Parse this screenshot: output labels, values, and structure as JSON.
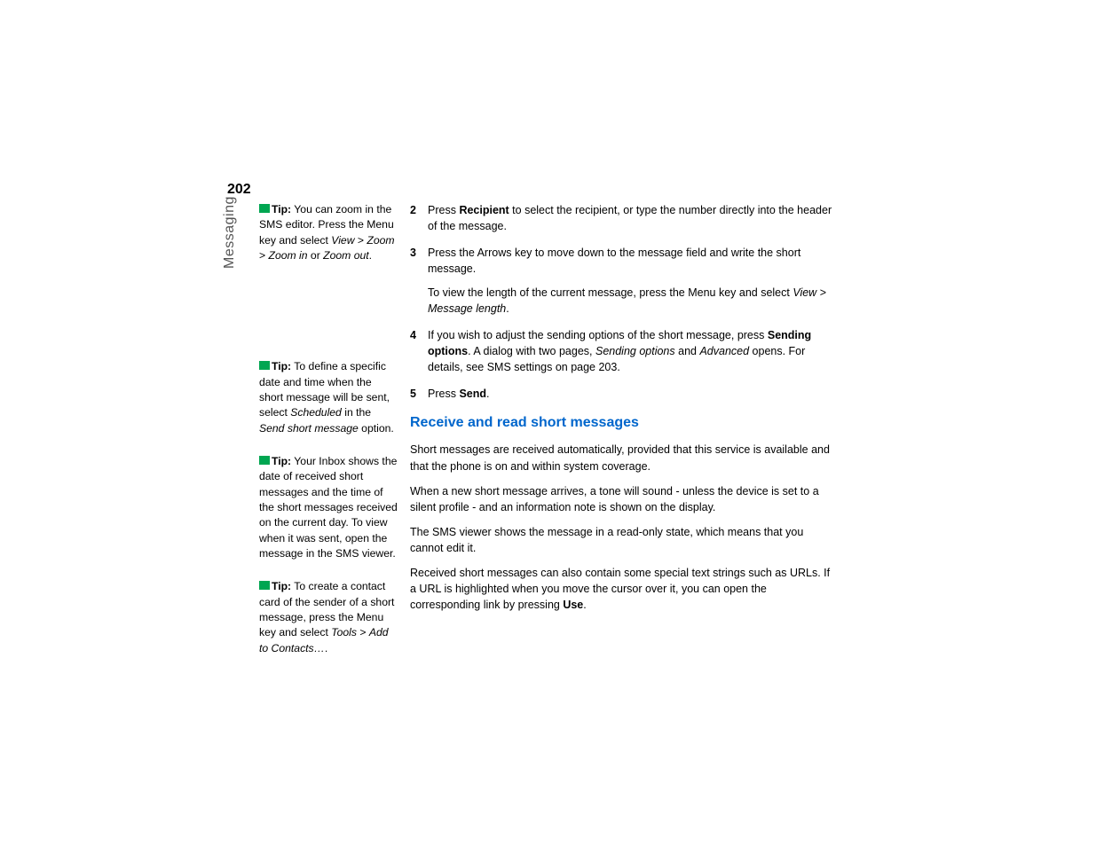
{
  "page_number": "202",
  "section_label": "Messaging",
  "sidebar": {
    "tips": [
      {
        "label": "Tip:",
        "text_a": " You can zoom in the SMS editor. Press the Menu key and select ",
        "italic_a": "View",
        "sep_a": " > ",
        "italic_b": "Zoom",
        "sep_b": " > ",
        "italic_c": "Zoom in",
        "mid": " or ",
        "italic_d": "Zoom out",
        "tail": "."
      },
      {
        "label": "Tip:",
        "text_a": " To define a specific date and time when the short message will be sent, select ",
        "italic_a": "Scheduled",
        "mid": " in the ",
        "italic_b": "Send short message",
        "tail": " option."
      },
      {
        "label": "Tip:",
        "text_a": " Your Inbox shows the date of received short messages and the time of the short messages received on the current day. To view when it was sent, open the message in the SMS viewer."
      },
      {
        "label": "Tip:",
        "text_a": " To create a contact card of the sender of a short message, press the Menu key and select ",
        "italic_a": "Tools",
        "sep_a": " > ",
        "italic_b": "Add to Contacts…",
        "tail": "."
      }
    ]
  },
  "main": {
    "steps": [
      {
        "num": "2",
        "pre": "Press ",
        "bold_a": "Recipient",
        "post": " to select the recipient, or type the number directly into the header of the message."
      },
      {
        "num": "3",
        "pre": "Press the Arrows key to move down to the message field and write the short message.",
        "sub_pre": "To view the length of the current message, press the Menu key and select ",
        "sub_italic_a": "View",
        "sub_sep": " > ",
        "sub_italic_b": "Message length",
        "sub_tail": "."
      },
      {
        "num": "4",
        "pre": "If you wish to adjust the sending options of the short message, press ",
        "bold_a": "Sending options",
        "mid": ". A dialog with two pages, ",
        "italic_a": "Sending options",
        "mid2": " and ",
        "italic_b": "Advanced",
        "post": " opens. For details, see SMS settings on page 203."
      },
      {
        "num": "5",
        "pre": "Press ",
        "bold_a": "Send",
        "post": "."
      }
    ],
    "heading": "Receive and read short messages",
    "paras": [
      "Short messages are received automatically, provided that this service is available and that the phone is on and within system coverage.",
      "When a new short message arrives, a tone will sound - unless the device is set to a silent profile - and an information note is shown on the display.",
      "The SMS viewer shows the message in a read-only state, which means that you cannot edit it."
    ],
    "para4_pre": "Received short messages can also contain some special text strings such as URLs. If a URL is highlighted when you move the cursor over it, you can open the corresponding link by pressing ",
    "para4_bold": "Use",
    "para4_post": "."
  }
}
